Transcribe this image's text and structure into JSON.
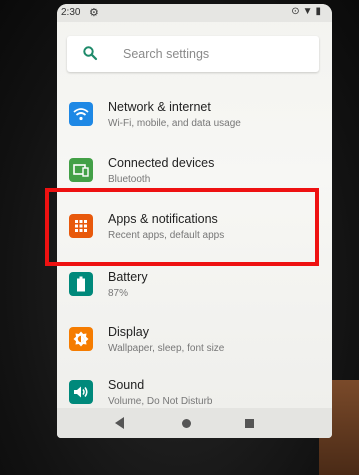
{
  "status_bar": {
    "time": "2:30"
  },
  "search": {
    "placeholder": "Search settings"
  },
  "settings_items": [
    {
      "title": "Network & internet",
      "subtitle": "Wi-Fi, mobile, and data usage",
      "icon": "wifi-icon",
      "color": "#1e88e5"
    },
    {
      "title": "Connected devices",
      "subtitle": "Bluetooth",
      "icon": "devices-icon",
      "color": "#43a047"
    },
    {
      "title": "Apps & notifications",
      "subtitle": "Recent apps, default apps",
      "icon": "apps-grid-icon",
      "color": "#e8590c"
    },
    {
      "title": "Battery",
      "subtitle": "87%",
      "icon": "battery-icon",
      "color": "#00897b"
    },
    {
      "title": "Display",
      "subtitle": "Wallpaper, sleep, font size",
      "icon": "brightness-icon",
      "color": "#f57c00"
    },
    {
      "title": "Sound",
      "subtitle": "Volume, Do Not Disturb",
      "icon": "volume-icon",
      "color": "#00897b"
    }
  ],
  "highlight": {
    "color": "#ee1111",
    "target": "Apps & notifications"
  }
}
